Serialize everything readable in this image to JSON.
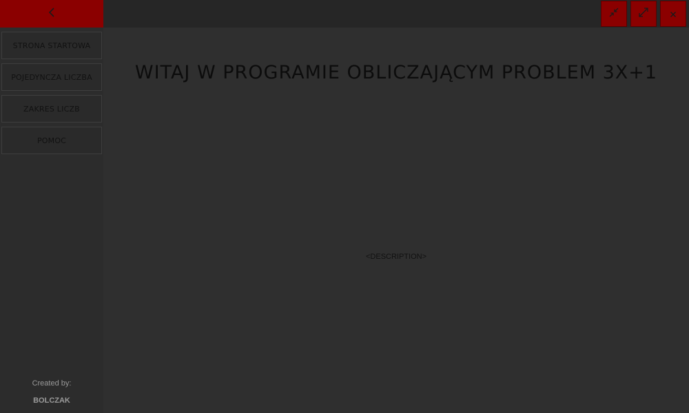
{
  "sidebar": {
    "back_icon": "chevron-left-icon",
    "items": [
      {
        "label": "STRONA STARTOWA"
      },
      {
        "label": "POJEDYNCZA LICZBA"
      },
      {
        "label": "ZAKRES LICZB"
      },
      {
        "label": "POMOC"
      }
    ],
    "credits_label": "Created by:",
    "credits_author": "BOLCZAK"
  },
  "titlebar": {
    "minimize_icon": "shrink-icon",
    "maximize_icon": "expand-icon",
    "close_icon": "close-icon"
  },
  "main": {
    "title": "WITAJ W PROGRAMIE OBLICZAJĄCYM PROBLEM 3X+1",
    "description": "<DESCRIPTION>"
  },
  "colors": {
    "accent": "#8b0000",
    "background": "#2f2f2f",
    "sidebar": "#2c2c2c",
    "text": "#0c0c0c"
  }
}
